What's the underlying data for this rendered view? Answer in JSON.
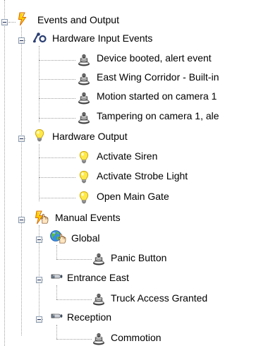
{
  "tree": {
    "root": {
      "label": "Events and Output",
      "icon": "lightning-folder-icon"
    },
    "hardware_input": {
      "label": "Hardware Input Events",
      "icon": "input-events-icon",
      "items": [
        {
          "label": "Device booted, alert event",
          "icon": "event-icon"
        },
        {
          "label": "East Wing Corridor - Built-in",
          "icon": "event-icon"
        },
        {
          "label": "Motion started on camera 1",
          "icon": "event-icon"
        },
        {
          "label": "Tampering on camera 1, ale",
          "icon": "event-icon"
        }
      ]
    },
    "hardware_output": {
      "label": "Hardware Output",
      "icon": "light-bulb-icon",
      "items": [
        {
          "label": "Activate Siren",
          "icon": "light-bulb-icon"
        },
        {
          "label": "Activate Strobe Light",
          "icon": "light-bulb-icon"
        },
        {
          "label": "Open Main Gate",
          "icon": "light-bulb-icon"
        }
      ]
    },
    "manual_events": {
      "label": "Manual Events",
      "icon": "manual-events-hand-icon",
      "global": {
        "label": "Global",
        "icon": "globe-hand-icon",
        "items": [
          {
            "label": "Panic Button",
            "icon": "event-icon"
          }
        ]
      },
      "entrance_east": {
        "label": "Entrance East",
        "icon": "camera-icon",
        "items": [
          {
            "label": "Truck Access Granted",
            "icon": "event-icon"
          }
        ]
      },
      "reception": {
        "label": "Reception",
        "icon": "camera-icon",
        "items": [
          {
            "label": "Commotion",
            "icon": "event-icon"
          }
        ]
      }
    }
  }
}
